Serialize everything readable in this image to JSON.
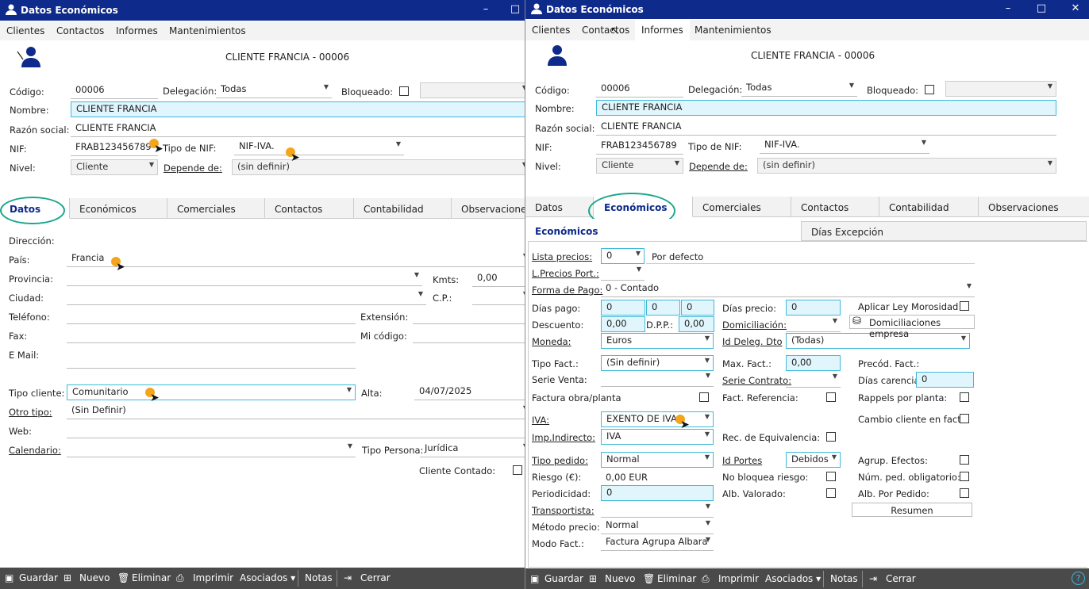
{
  "window_title": "Datos Económicos",
  "menu": [
    "Clientes",
    "Contactos",
    "Informes",
    "Mantenimientos"
  ],
  "client_header": "CLIENTE FRANCIA - 00006",
  "header_fields": {
    "codigo_label": "Código:",
    "codigo": "00006",
    "delegacion_label": "Delegación:",
    "delegacion": "Todas",
    "bloqueado_label": "Bloqueado:",
    "nombre_label": "Nombre:",
    "nombre": "CLIENTE FRANCIA",
    "razon_label": "Razón social:",
    "razon": "CLIENTE FRANCIA",
    "nif_label": "NIF:",
    "nif": "FRAB123456789",
    "tipo_nif_label": "Tipo de NIF:",
    "tipo_nif": "NIF-IVA.",
    "nivel_label": "Nivel:",
    "nivel": "Cliente",
    "depende_label": "Depende de:",
    "depende": "(sin definir)"
  },
  "tabs": [
    "Datos",
    "Económicos",
    "Comerciales",
    "Contactos",
    "Contabilidad",
    "Observaciones"
  ],
  "datos": {
    "direccion_label": "Dirección:",
    "pais_label": "País:",
    "pais": "Francia",
    "provincia_label": "Provincia:",
    "kmts_label": "Kmts:",
    "kmts": "0,00",
    "ciudad_label": "Ciudad:",
    "cp_label": "C.P.:",
    "telefono_label": "Teléfono:",
    "extension_label": "Extensión:",
    "fax_label": "Fax:",
    "micodigo_label": "Mi código:",
    "email_label": "E Mail:",
    "tipo_cliente_label": "Tipo cliente:",
    "tipo_cliente": "Comunitario",
    "alta_label": "Alta:",
    "alta": "04/07/2025",
    "otro_tipo_label": "Otro tipo:",
    "otro_tipo": "(Sin Definir)",
    "web_label": "Web:",
    "calendario_label": "Calendario:",
    "tipo_persona_label": "Tipo Persona:",
    "tipo_persona": "Jurídica",
    "cliente_contado_label": "Cliente Contado:"
  },
  "subtabs": [
    "Económicos",
    "Días Excepción"
  ],
  "economicos": {
    "lista_precios_label": "Lista precios:",
    "lista_precios": "0",
    "por_defecto": "Por defecto",
    "lprecios_port_label": "L.Precios Port.:",
    "forma_pago_label": "Forma de Pago:",
    "forma_pago": "0 - Contado",
    "dias_pago_label": "Días pago:",
    "dias_pago": [
      "0",
      "0",
      "0"
    ],
    "dias_precio_label": "Días precio:",
    "dias_precio": "0",
    "aplicar_ley_label": "Aplicar Ley Morosidad",
    "descuento_label": "Descuento:",
    "descuento": "0,00",
    "dpp_label": "D.P.P.:",
    "dpp": "0,00",
    "domiciliacion_label": "Domiciliación:",
    "domiciliaciones_btn": "Domiciliaciones empresa",
    "moneda_label": "Moneda:",
    "moneda": "Euros",
    "id_deleg_label": "Id Deleg. Dto",
    "id_deleg": "(Todas)",
    "tipo_fact_label": "Tipo Fact.:",
    "tipo_fact": "(Sin definir)",
    "max_fact_label": "Max. Fact.:",
    "max_fact": "0,00",
    "precod_label": "Precód. Fact.:",
    "serie_venta_label": "Serie Venta:",
    "serie_contrato_label": "Serie Contrato:",
    "dias_carencia_label": "Días carencia:",
    "dias_carencia": "0",
    "factura_obra_label": "Factura obra/planta",
    "fact_ref_label": "Fact. Referencia:",
    "rappels_label": "Rappels por planta:",
    "iva_label": "IVA:",
    "iva": "EXENTO DE IVA",
    "cambio_cliente_label": "Cambio cliente en fact.:",
    "imp_indirecto_label": "Imp.Indirecto:",
    "imp_indirecto": "IVA",
    "rec_equiv_label": "Rec. de Equivalencia:",
    "tipo_pedido_label": "Tipo pedido:",
    "tipo_pedido": "Normal",
    "id_portes_label": "Id Portes",
    "id_portes": "Debidos",
    "agrup_label": "Agrup. Efectos:",
    "riesgo_label": "Riesgo (€):",
    "riesgo": "0,00 EUR",
    "no_bloquea_label": "No bloquea riesgo:",
    "num_ped_label": "Núm. ped. obligatorio:",
    "periodicidad_label": "Periodicidad:",
    "periodicidad": "0",
    "alb_valorado_label": "Alb. Valorado:",
    "alb_pedido_label": "Alb. Por Pedido:",
    "resumen_btn": "Resumen",
    "transportista_label": "Transportista:",
    "metodo_precio_label": "Método precio:",
    "metodo_precio": "Normal",
    "modo_fact_label": "Modo Fact.:",
    "modo_fact": "Factura Agrupa Albara"
  },
  "toolbar": {
    "guardar": "Guardar",
    "nuevo": "Nuevo",
    "eliminar": "Eliminar",
    "imprimir": "Imprimir",
    "asociados": "Asociados",
    "notas": "Notas",
    "cerrar": "Cerrar"
  },
  "colors": {
    "titlebar": "#0e2a8a",
    "field_border": "#40b9d9",
    "highlight_ring": "#1aa58b",
    "cursor_dot": "#f4a51c",
    "toolbar": "#4a4a4a"
  }
}
